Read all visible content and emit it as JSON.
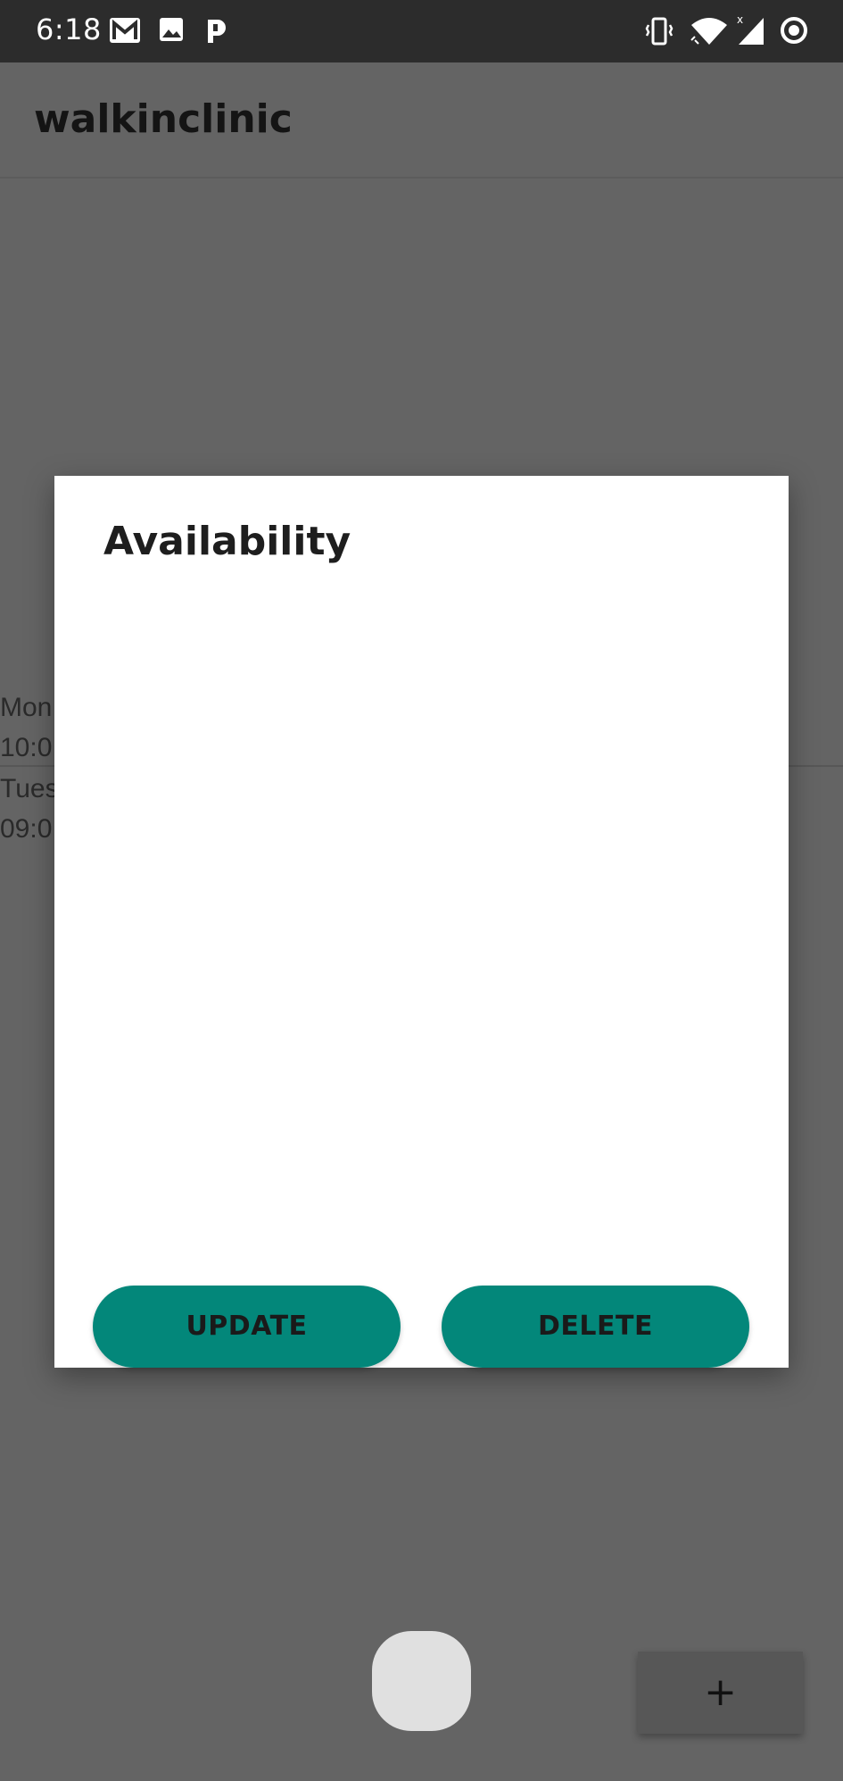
{
  "status_bar": {
    "time": "6:18",
    "left_icons": [
      "gmail-icon",
      "image-icon",
      "p-app-icon"
    ],
    "right_icons": [
      "vibrate-icon",
      "wifi-icon",
      "signal-icon",
      "circle-status-icon"
    ]
  },
  "app_bar": {
    "title": "walkinclinic"
  },
  "background_list": {
    "items": [
      {
        "line1": "Mon",
        "line2": "10:0"
      },
      {
        "line1": "Tues",
        "line2": "09:0"
      }
    ]
  },
  "dialog": {
    "title": "Availability",
    "update_label": "UPDATE",
    "delete_label": "DELETE",
    "button_color": "#03877a"
  },
  "fab": {
    "label": "+"
  },
  "colors": {
    "status_bar": "#2c2c2c",
    "scrim_background": "#646464",
    "accent": "#03877a"
  }
}
